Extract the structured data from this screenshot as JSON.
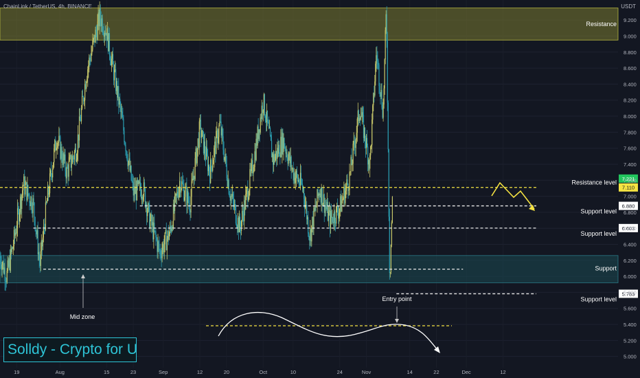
{
  "header": {
    "title": "ChainLink / TetherUS, 4h, BINANCE",
    "currency": "USDT"
  },
  "brand": {
    "text": "Solldy - Crypto for U"
  },
  "colors": {
    "background": "#131722",
    "up": "#c8c86a",
    "down": "#2a9db0",
    "resistance_zone": "#7a7a30",
    "support_zone": "#1b4a52",
    "dashed_white": "#e8e8e8",
    "dashed_yellow": "#f5e342",
    "arrow_yellow": "#f5e342",
    "last_price": "#22c55e",
    "brand": "#2ec4d6"
  },
  "chart_data": {
    "type": "candlestick",
    "symbol": "ChainLink / TetherUS",
    "interval": "4h",
    "exchange": "BINANCE",
    "y_axis": {
      "ticks": [
        "5.000",
        "5.200",
        "5.400",
        "5.600",
        "5.800",
        "6.000",
        "6.200",
        "6.400",
        "6.600",
        "6.800",
        "7.000",
        "7.200",
        "7.400",
        "7.600",
        "7.800",
        "8.000",
        "8.200",
        "8.400",
        "8.600",
        "8.800",
        "9.000",
        "9.200"
      ],
      "ylim": [
        4.86,
        9.45
      ]
    },
    "x_axis": {
      "ticks": [
        "19",
        "Aug",
        "15",
        "23",
        "Sep",
        "12",
        "20",
        "Oct",
        "10",
        "24",
        "Nov",
        "14",
        "22",
        "Dec",
        "12"
      ]
    },
    "price_path": [
      {
        "t": "Jul 14",
        "p": 6.25
      },
      {
        "t": "Jul 16",
        "p": 6.0
      },
      {
        "t": "Jul 18",
        "p": 6.4
      },
      {
        "t": "Jul 21",
        "p": 7.15
      },
      {
        "t": "Jul 24",
        "p": 6.9
      },
      {
        "t": "Jul 26",
        "p": 6.15
      },
      {
        "t": "Jul 28",
        "p": 6.9
      },
      {
        "t": "Jul 31",
        "p": 7.75
      },
      {
        "t": "Aug 3",
        "p": 7.3
      },
      {
        "t": "Aug 6",
        "p": 7.6
      },
      {
        "t": "Aug 9",
        "p": 8.55
      },
      {
        "t": "Aug 13",
        "p": 9.25
      },
      {
        "t": "Aug 15",
        "p": 9.05
      },
      {
        "t": "Aug 18",
        "p": 8.35
      },
      {
        "t": "Aug 20",
        "p": 7.85
      },
      {
        "t": "Aug 23",
        "p": 7.05
      },
      {
        "t": "Aug 26",
        "p": 7.1
      },
      {
        "t": "Aug 28",
        "p": 6.7
      },
      {
        "t": "Aug 31",
        "p": 6.3
      },
      {
        "t": "Sep 3",
        "p": 6.55
      },
      {
        "t": "Sep 6",
        "p": 7.2
      },
      {
        "t": "Sep 9",
        "p": 6.9
      },
      {
        "t": "Sep 12",
        "p": 7.85
      },
      {
        "t": "Sep 15",
        "p": 7.3
      },
      {
        "t": "Sep 18",
        "p": 7.9
      },
      {
        "t": "Sep 21",
        "p": 7.05
      },
      {
        "t": "Sep 24",
        "p": 6.6
      },
      {
        "t": "Sep 28",
        "p": 7.4
      },
      {
        "t": "Oct 1",
        "p": 8.2
      },
      {
        "t": "Oct 4",
        "p": 7.45
      },
      {
        "t": "Oct 7",
        "p": 7.7
      },
      {
        "t": "Oct 10",
        "p": 7.3
      },
      {
        "t": "Oct 13",
        "p": 7.1
      },
      {
        "t": "Oct 15",
        "p": 6.5
      },
      {
        "t": "Oct 18",
        "p": 7.1
      },
      {
        "t": "Oct 21",
        "p": 6.7
      },
      {
        "t": "Oct 24",
        "p": 6.85
      },
      {
        "t": "Oct 27",
        "p": 7.25
      },
      {
        "t": "Oct 30",
        "p": 8.1
      },
      {
        "t": "Nov 2",
        "p": 7.4
      },
      {
        "t": "Nov 4",
        "p": 8.8
      },
      {
        "t": "Nov 6",
        "p": 8.05
      },
      {
        "t": "Nov 7",
        "p": 9.35
      },
      {
        "t": "Nov 8",
        "p": 5.95
      },
      {
        "t": "Nov 9",
        "p": 7.2
      }
    ],
    "last_price": "7.221",
    "price_tags": [
      "7.110",
      "6.880",
      "6.603",
      "5.783"
    ],
    "zones": [
      {
        "label": "Resistance",
        "from": 8.95,
        "to": 9.35
      },
      {
        "label": "Support",
        "from": 5.92,
        "to": 6.26
      }
    ],
    "levels": [
      {
        "label": "Resistance level",
        "price": 7.11,
        "tag": "7.110",
        "color": "yellow",
        "from": "Jul 14",
        "to": "Dec 22"
      },
      {
        "label": "Support level",
        "price": 6.88,
        "tag": "6.880",
        "color": "white",
        "from": "Aug 25",
        "to": "Dec 22"
      },
      {
        "label": "Support level",
        "price": 6.603,
        "tag": "6.603",
        "color": "white",
        "from": "Jul 24",
        "to": "Dec 22"
      },
      {
        "label": "Support",
        "price": 6.09,
        "tag": "",
        "color": "white",
        "from": "Jul 27",
        "to": "Nov 30"
      },
      {
        "label": "Support level",
        "price": 5.783,
        "tag": "5.783",
        "color": "white",
        "from": "Nov 10",
        "to": "Dec 22"
      }
    ],
    "annotations": [
      {
        "text": "Mid zone"
      },
      {
        "text": "Entry point"
      }
    ]
  }
}
